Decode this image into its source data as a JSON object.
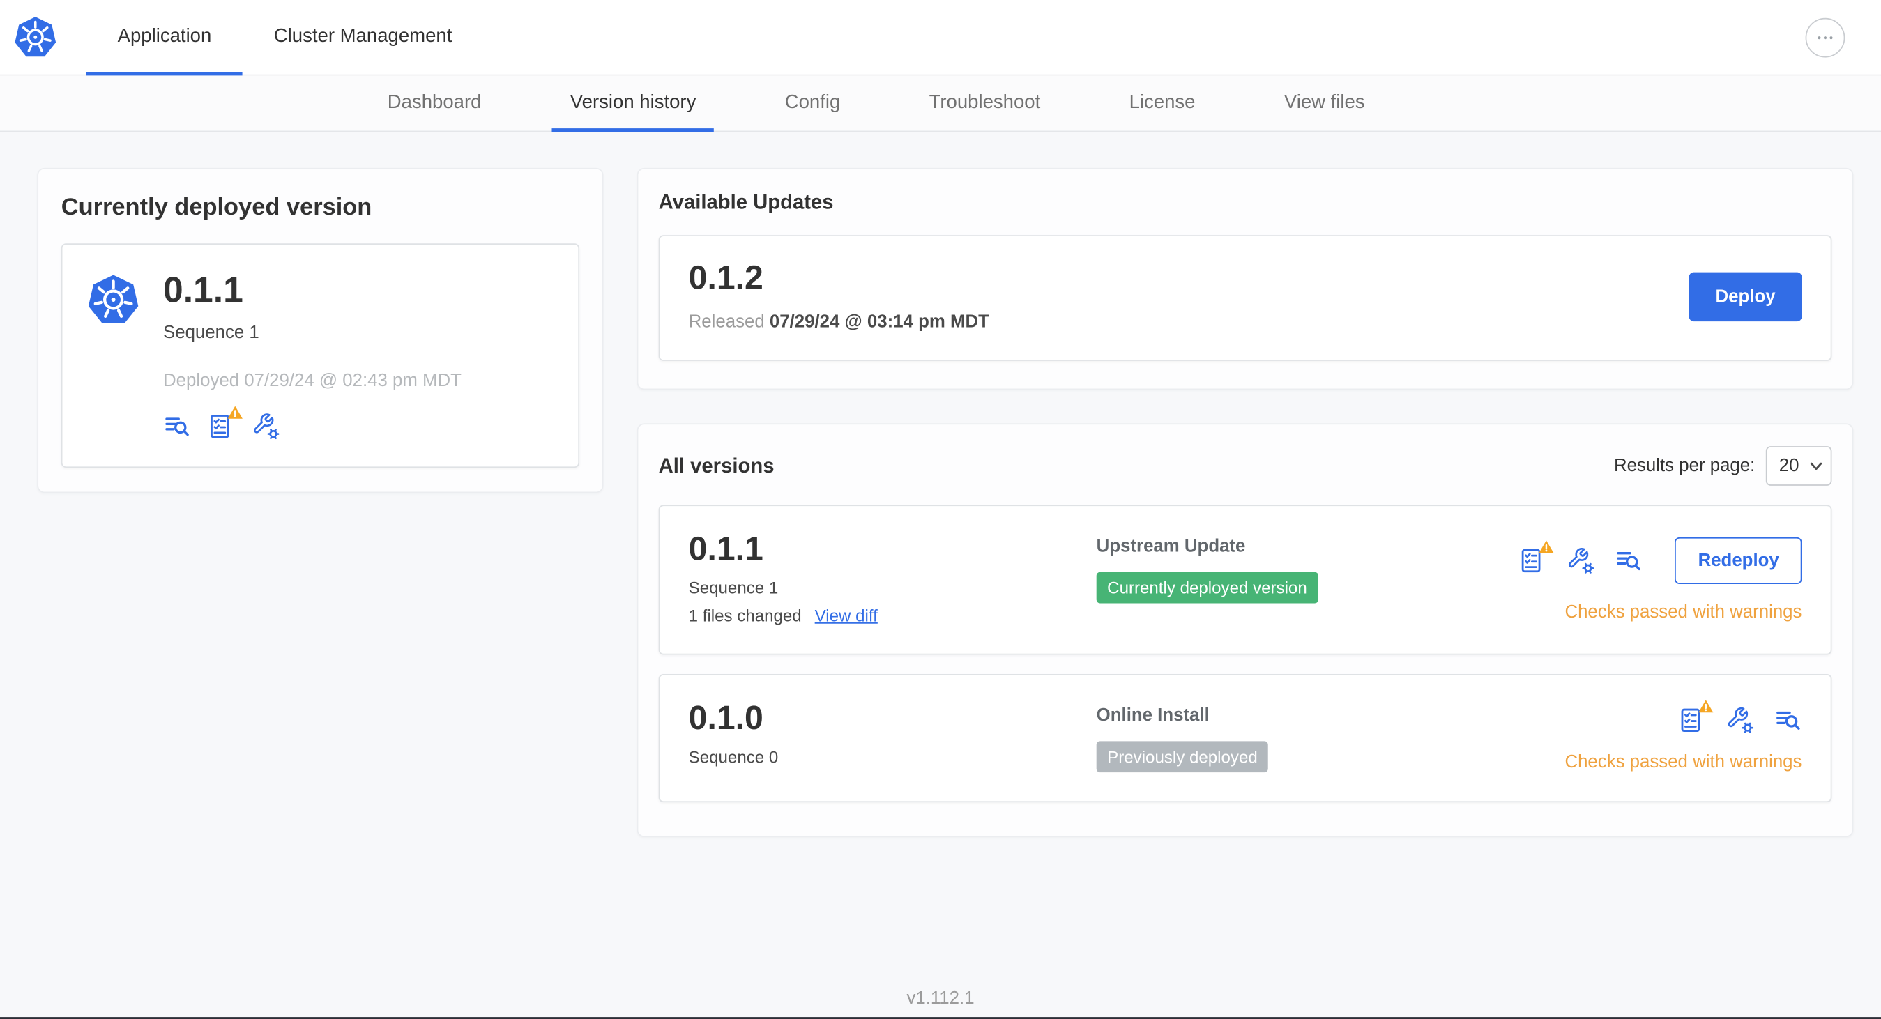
{
  "colors": {
    "accent": "#326de6",
    "success": "#47b475",
    "badge_gray": "#b2b8bd",
    "warning": "#efa23f",
    "warning_triangle": "#f5a623"
  },
  "header": {
    "tabs": [
      {
        "label": "Application"
      },
      {
        "label": "Cluster Management"
      }
    ]
  },
  "subnav": {
    "tabs": [
      {
        "label": "Dashboard"
      },
      {
        "label": "Version history"
      },
      {
        "label": "Config"
      },
      {
        "label": "Troubleshoot"
      },
      {
        "label": "License"
      },
      {
        "label": "View files"
      }
    ]
  },
  "current_version": {
    "title": "Currently deployed version",
    "version": "0.1.1",
    "sequence": "Sequence 1",
    "deployed": "Deployed 07/29/24 @ 02:43 pm MDT"
  },
  "available_updates": {
    "title": "Available Updates",
    "version": "0.1.2",
    "released_label": "Released",
    "released_date": "07/29/24 @ 03:14 pm MDT",
    "deploy_label": "Deploy"
  },
  "all_versions": {
    "title": "All versions",
    "results_per_page_label": "Results per page:",
    "results_per_page_value": "20",
    "rows": [
      {
        "version": "0.1.1",
        "sequence": "Sequence 1",
        "files_changed": "1 files changed",
        "view_diff_label": "View diff",
        "source": "Upstream Update",
        "badge": "Currently deployed version",
        "status": "Checks passed with warnings",
        "redeploy_label": "Redeploy"
      },
      {
        "version": "0.1.0",
        "sequence": "Sequence 0",
        "source": "Online Install",
        "badge": "Previously deployed",
        "status": "Checks passed with warnings"
      }
    ]
  },
  "footer": {
    "version": "v1.112.1"
  },
  "icons": {
    "app_logo": "kubernetes-helm",
    "more_menu": "ellipsis",
    "view_logs": "lines-with-magnifier",
    "preflight_checks": "checklist",
    "edit_config": "wrench-gear",
    "warning_badge": "warning-triangle",
    "select_chevron": "chevron-down"
  }
}
